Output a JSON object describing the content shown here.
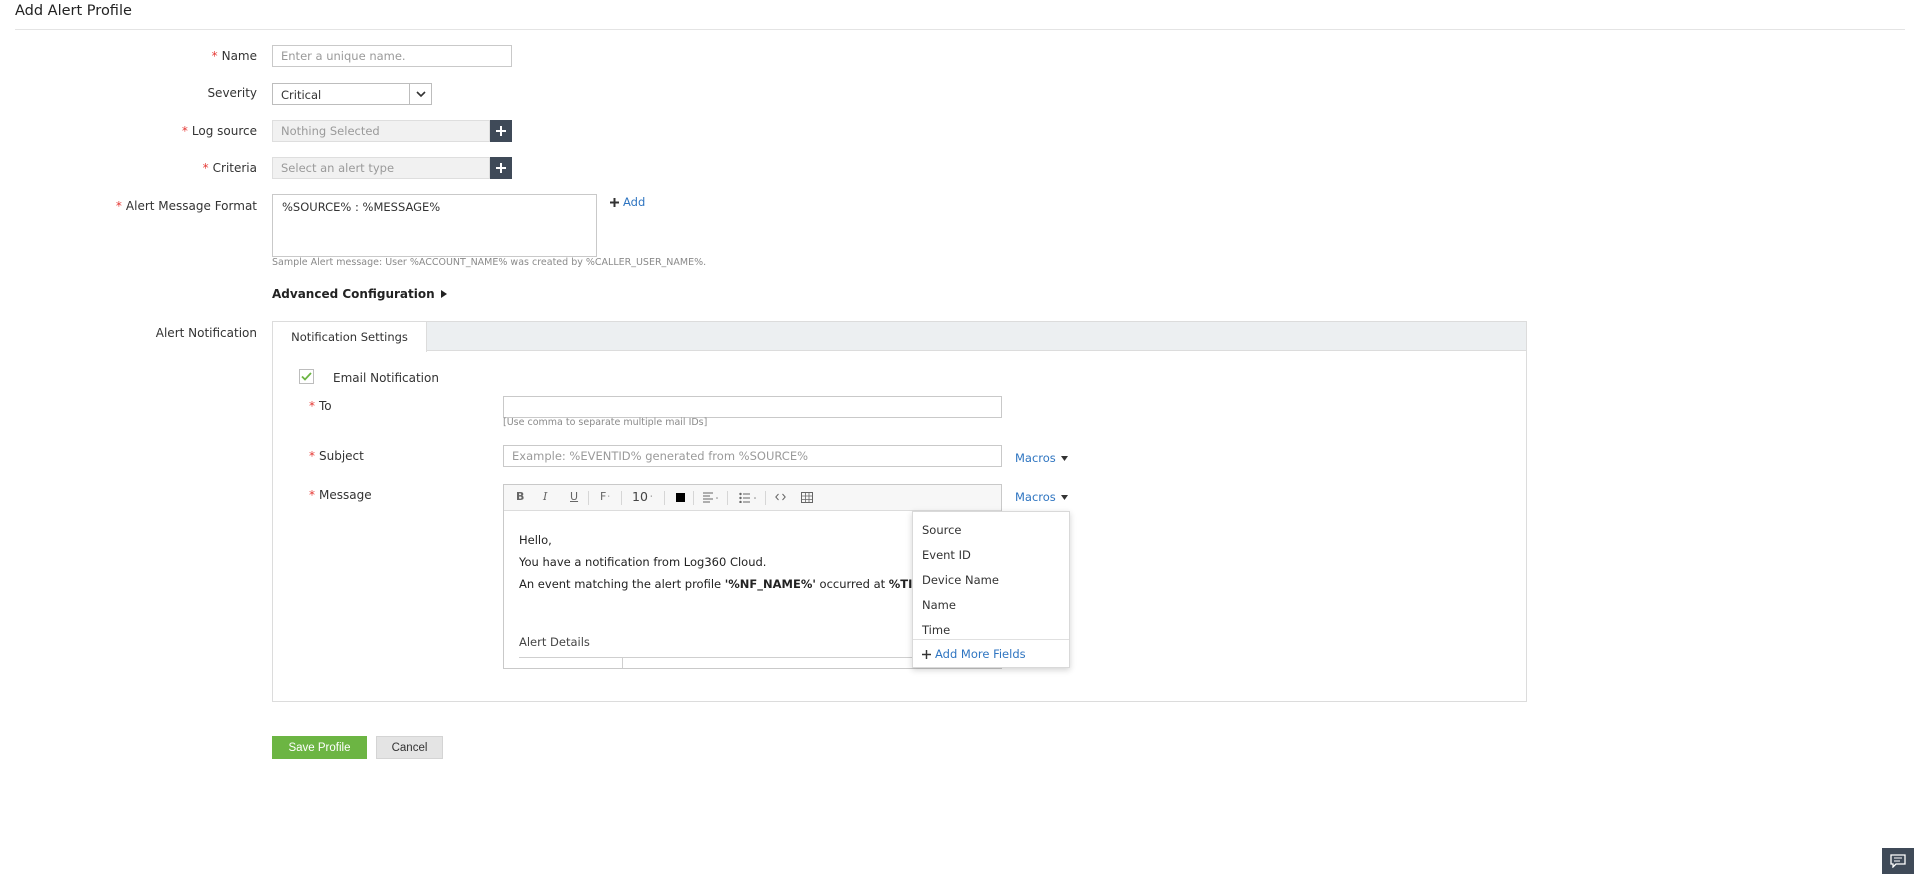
{
  "page": {
    "title": "Add Alert Profile"
  },
  "form": {
    "name": {
      "label": "Name",
      "placeholder": "Enter a unique name."
    },
    "severity": {
      "label": "Severity",
      "value": "Critical"
    },
    "log_source": {
      "label": "Log source",
      "placeholder": "Nothing Selected"
    },
    "criteria": {
      "label": "Criteria",
      "placeholder": "Select an alert type"
    },
    "message_format": {
      "label": "Alert Message Format",
      "value": "%SOURCE% : %MESSAGE%",
      "add_label": "Add",
      "sample": "Sample Alert message: User %ACCOUNT_NAME% was created by %CALLER_USER_NAME%."
    },
    "advanced_config": "Advanced Configuration"
  },
  "notification": {
    "label": "Alert Notification",
    "tab": "Notification Settings",
    "email_label": "Email Notification",
    "email_checked": true,
    "to": {
      "label": "To",
      "hint": "[Use comma to separate multiple mail IDs]"
    },
    "subject": {
      "label": "Subject",
      "placeholder": "Example: %EVENTID% generated from %SOURCE%"
    },
    "message_label": "Message",
    "macros_label": "Macros",
    "editor": {
      "font_size": "10",
      "line1": "Hello,",
      "line2": "You have a notification from Log360 Cloud.",
      "line3_prefix": "An event matching the alert profile ",
      "line3_bold": "'%NF_NAME%'",
      "line3_mid": " occurred at ",
      "line3_bold2": "%TI",
      "alert_details": "Alert Details"
    }
  },
  "macros_dropdown": {
    "items": [
      "Source",
      "Event ID",
      "Device Name",
      "Name",
      "Time"
    ],
    "footer": "Add More Fields"
  },
  "actions": {
    "save": "Save Profile",
    "cancel": "Cancel"
  },
  "colors": {
    "accent": "#2f75c1",
    "required": "#e53935",
    "save": "#6cb543",
    "dark": "#3f4a58"
  }
}
